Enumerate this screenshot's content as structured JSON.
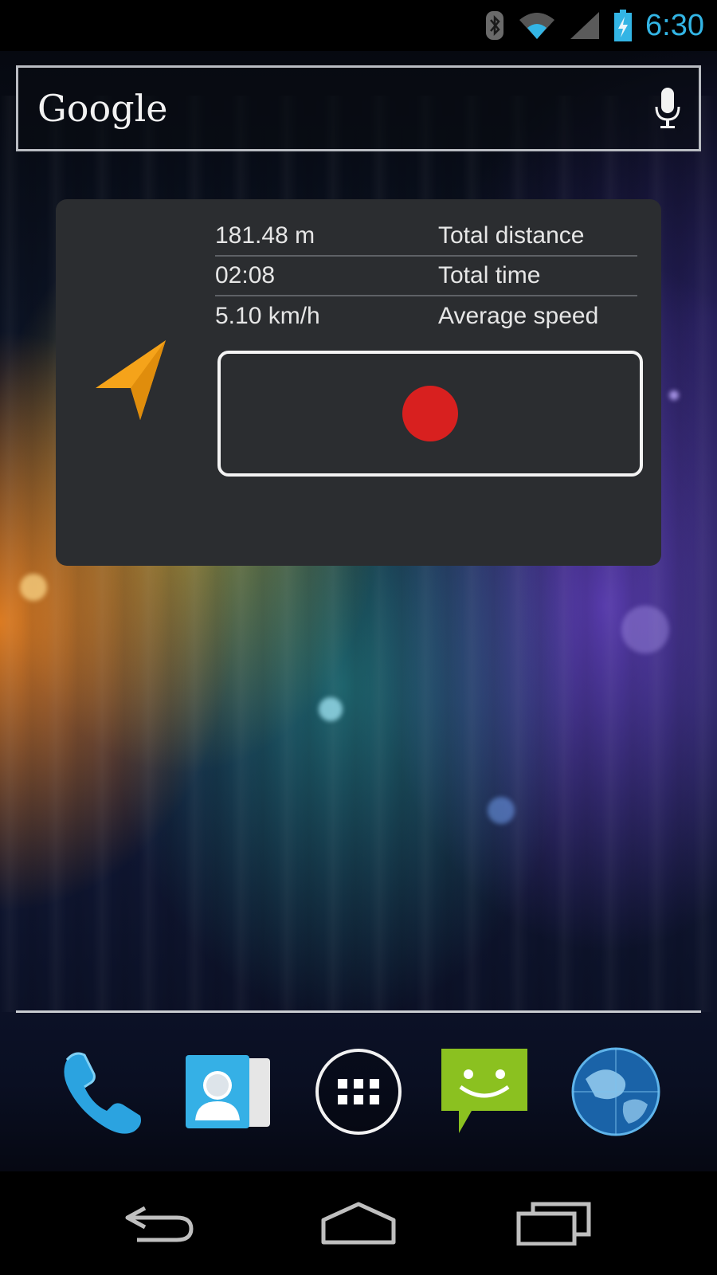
{
  "status_bar": {
    "time": "6:30",
    "icons": [
      "bluetooth-icon",
      "wifi-icon",
      "signal-icon",
      "battery-charging-icon"
    ],
    "accent_color": "#33b5e5"
  },
  "search": {
    "logo_text": "Google",
    "mic_icon": "mic-icon"
  },
  "widget": {
    "icon": "navigation-arrow-icon",
    "accent_color": "#f5a31a",
    "stats": [
      {
        "value": "181.48 m",
        "label": "Total distance"
      },
      {
        "value": "02:08",
        "label": "Total time"
      },
      {
        "value": "5.10 km/h",
        "label": "Average speed"
      }
    ],
    "record_button_icon": "record-icon",
    "record_color": "#d8201f"
  },
  "dock": {
    "items": [
      "phone-icon",
      "contacts-icon",
      "all-apps-icon",
      "messaging-icon",
      "browser-icon"
    ]
  },
  "nav_bar": {
    "items": [
      "back-icon",
      "home-icon",
      "recent-apps-icon"
    ]
  }
}
